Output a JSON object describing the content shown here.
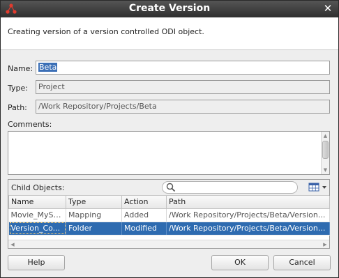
{
  "window": {
    "title": "Create Version"
  },
  "header": {
    "description": "Creating version of a version controlled ODI object."
  },
  "form": {
    "name_label": "Name:",
    "name_value": "Beta",
    "type_label": "Type:",
    "type_value": "Project",
    "path_label": "Path:",
    "path_value": "/Work Repository/Projects/Beta",
    "comments_label": "Comments:",
    "comments_value": ""
  },
  "child_objects": {
    "label": "Child Objects:",
    "search_placeholder": "",
    "columns": [
      "Name",
      "Type",
      "Action",
      "Path"
    ],
    "rows": [
      {
        "name": "Movie_MySQ...",
        "type": "Mapping",
        "action": "Added",
        "path": "/Work Repository/Projects/Beta/Version...",
        "selected": false
      },
      {
        "name": "Version_Co...",
        "type": "Folder",
        "action": "Modified",
        "path": "/Work Repository/Projects/Beta/Version...",
        "selected": true
      }
    ]
  },
  "buttons": {
    "help": "Help",
    "ok": "OK",
    "cancel": "Cancel"
  },
  "icons": {
    "app": "odi-app-icon",
    "close": "close-icon",
    "search": "search-icon",
    "columns": "columns-menu-icon"
  },
  "colors": {
    "titlebar": "#3a3a3a",
    "selection": "#2e6bb0"
  }
}
